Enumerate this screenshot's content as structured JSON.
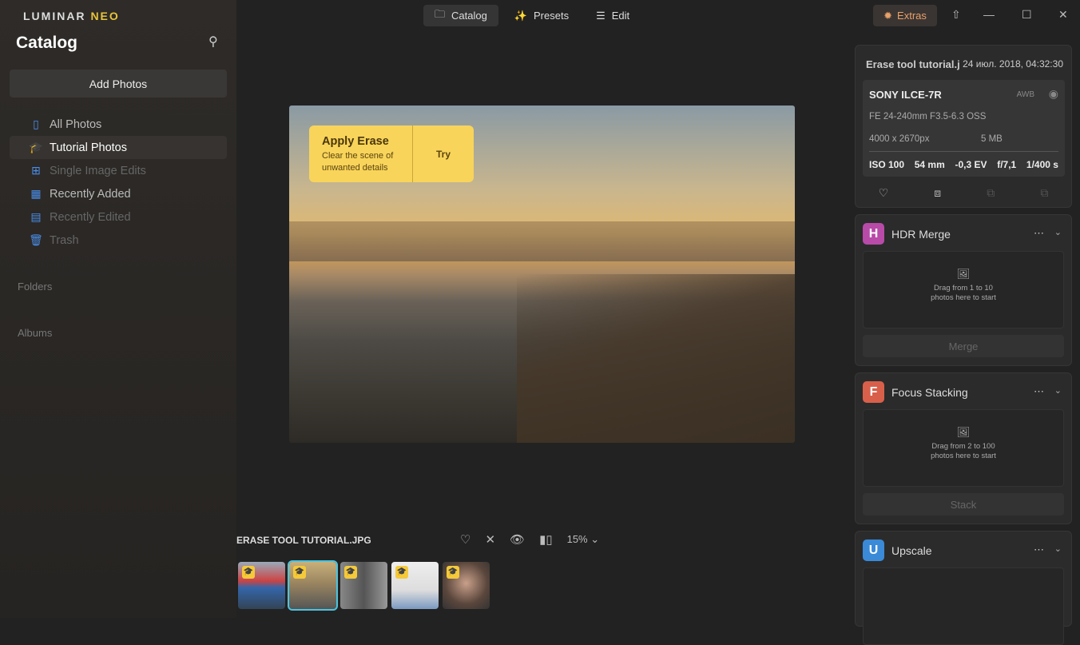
{
  "app": {
    "logo_main": "LUMINAR",
    "logo_accent": "NEO"
  },
  "topbar": {
    "catalog": "Catalog",
    "presets": "Presets",
    "edit": "Edit",
    "extras": "Extras"
  },
  "sidebar": {
    "title": "Catalog",
    "add_photos": "Add Photos",
    "items": [
      {
        "label": "All Photos"
      },
      {
        "label": "Tutorial Photos"
      },
      {
        "label": "Single Image Edits"
      },
      {
        "label": "Recently Added"
      },
      {
        "label": "Recently Edited"
      },
      {
        "label": "Trash"
      }
    ],
    "folders": "Folders",
    "albums": "Albums"
  },
  "tooltip": {
    "title": "Apply Erase",
    "desc": "Clear the scene of unwanted details",
    "try": "Try"
  },
  "viewer": {
    "filename": "ERASE TOOL TUTORIAL.JPG",
    "zoom": "15%"
  },
  "info": {
    "title": "Erase tool tutorial.j",
    "date": "24 июл. 2018, 04:32:30",
    "camera": "SONY ILCE-7R",
    "wb": "AWB",
    "lens": "FE 24-240mm F3.5-6.3 OSS",
    "resolution": "4000 x 2670px",
    "size": "5 MB",
    "iso": "ISO 100",
    "focal": "54 mm",
    "ev": "-0,3 EV",
    "aperture": "f/7,1",
    "shutter": "1/400 s"
  },
  "tools": [
    {
      "letter": "H",
      "name": "HDR Merge",
      "hint1": "Drag from 1 to 10",
      "hint2": "photos here to start",
      "button": "Merge",
      "color": "#b84aa8"
    },
    {
      "letter": "F",
      "name": "Focus Stacking",
      "hint1": "Drag from 2 to 100",
      "hint2": "photos here to start",
      "button": "Stack",
      "color": "#d8604a"
    },
    {
      "letter": "U",
      "name": "Upscale",
      "color": "#3a8ad8"
    }
  ]
}
